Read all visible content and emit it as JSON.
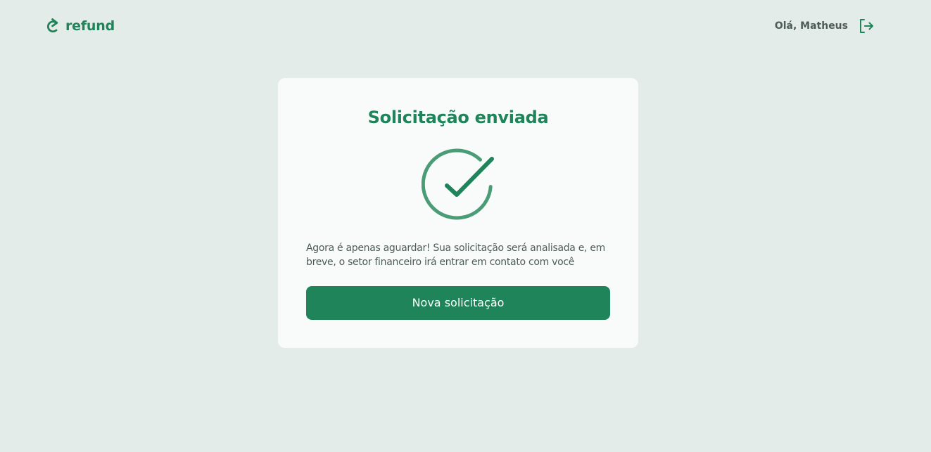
{
  "header": {
    "brand": {
      "name": "refund",
      "icon": "refresh-arrow-icon"
    },
    "user": {
      "greeting": "Olá, Matheus",
      "logout_icon": "logout-icon"
    }
  },
  "card": {
    "title": "Solicitação enviada",
    "status_icon": "check-circle-icon",
    "message": "Agora é apenas aguardar! Sua solicitação será analisada e, em breve, o setor financeiro irá entrar em contato com você",
    "button_label": "Nova solicitação"
  },
  "colors": {
    "background": "#E4ECE9",
    "card": "#F9FBFA",
    "brand_green": "#1F8459",
    "icon_ring": "#4A9C76",
    "text_muted": "#4D5C57",
    "button_text": "#FFFFFF"
  }
}
